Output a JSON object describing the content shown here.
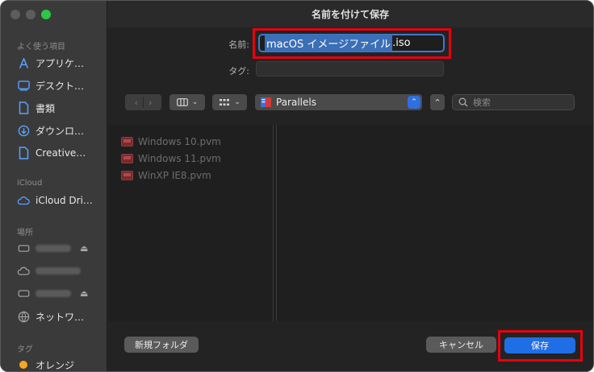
{
  "window": {
    "title": "名前を付けて保存"
  },
  "sidebar": {
    "favorites_header": "よく使う項目",
    "favorites": [
      {
        "label": "アプリケ…",
        "icon": "applications-icon"
      },
      {
        "label": "デスクト…",
        "icon": "desktop-icon"
      },
      {
        "label": "書類",
        "icon": "document-icon"
      },
      {
        "label": "ダウンロ…",
        "icon": "downloads-icon"
      },
      {
        "label": "Creative…",
        "icon": "file-icon"
      }
    ],
    "icloud_header": "iCloud",
    "icloud": [
      {
        "label": "iCloud Dri…",
        "icon": "icloud-icon"
      }
    ],
    "locations_header": "場所",
    "locations": [
      {
        "label": "",
        "icon": "drive-icon",
        "eject": true
      },
      {
        "label": "",
        "icon": "cloud-icon",
        "eject": false
      },
      {
        "label": "",
        "icon": "drive-icon",
        "eject": true
      },
      {
        "label": "ネットワ…",
        "icon": "network-icon",
        "eject": false
      }
    ],
    "tags_header": "タグ",
    "tags": [
      {
        "label": "オレンジ",
        "color": "#f5a623"
      }
    ]
  },
  "form": {
    "name_label": "名前:",
    "name_value_selected": "macOS イメージファイル",
    "name_value_ext": ".iso",
    "tag_label": "タグ:"
  },
  "toolbar": {
    "location": "Parallels",
    "search_placeholder": "検索"
  },
  "files": [
    {
      "name": "Windows 10.pvm"
    },
    {
      "name": "Windows 11.pvm"
    },
    {
      "name": "WinXP IE8.pvm"
    }
  ],
  "buttons": {
    "new_folder": "新規フォルダ",
    "cancel": "キャンセル",
    "save": "保存"
  },
  "colors": {
    "accent": "#1f6ee6",
    "highlight": "#e8000f",
    "tag_orange": "#f5a623"
  }
}
